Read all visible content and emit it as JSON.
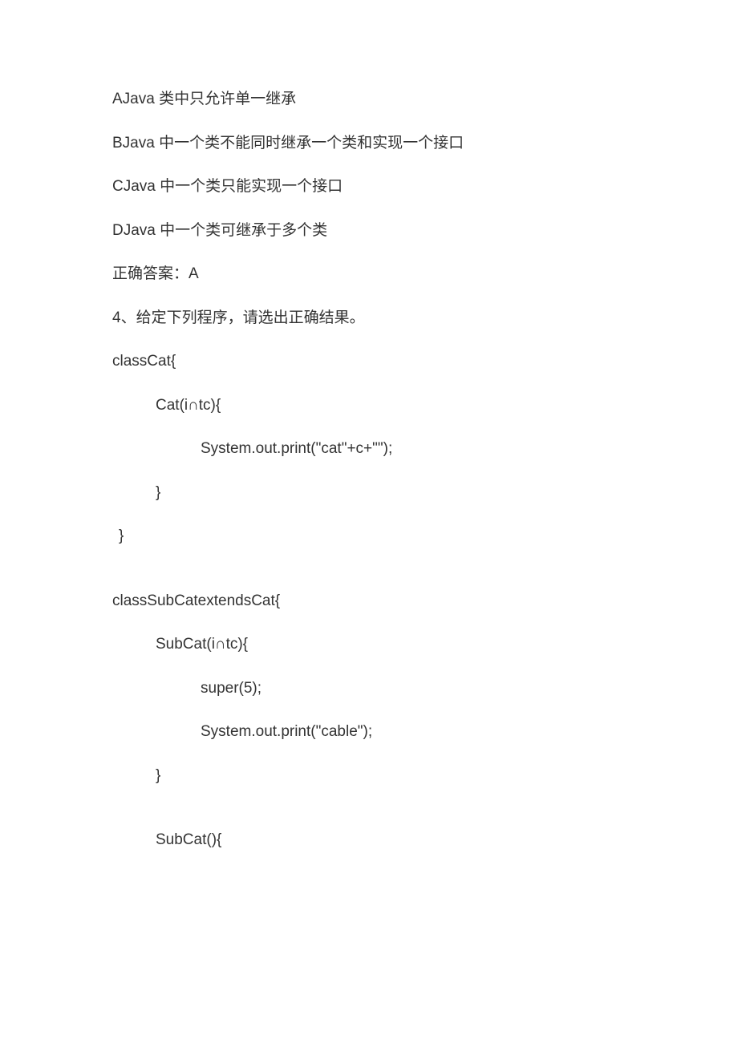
{
  "lines": {
    "optA": "AJava 类中只允许单一继承",
    "optB": "BJava 中一个类不能同时继承一个类和实现一个接口",
    "optC": "CJava 中一个类只能实现一个接口",
    "optD": "DJava 中一个类可继承于多个类",
    "answer": "正确答案：A",
    "q4": "4、给定下列程序，请选出正确结果。",
    "c1": "classCat{",
    "c2": "Cat(i∩tc){",
    "c3": "System.out.print(\"cat\"+c+\"\");",
    "c4": "}",
    "c5": "}",
    "c6": "classSubCatextendsCat{",
    "c7": "SubCat(i∩tc){",
    "c8": "super(5);",
    "c9": "System.out.print(\"cable\");",
    "c10": "}",
    "c11": "SubCat(){"
  }
}
